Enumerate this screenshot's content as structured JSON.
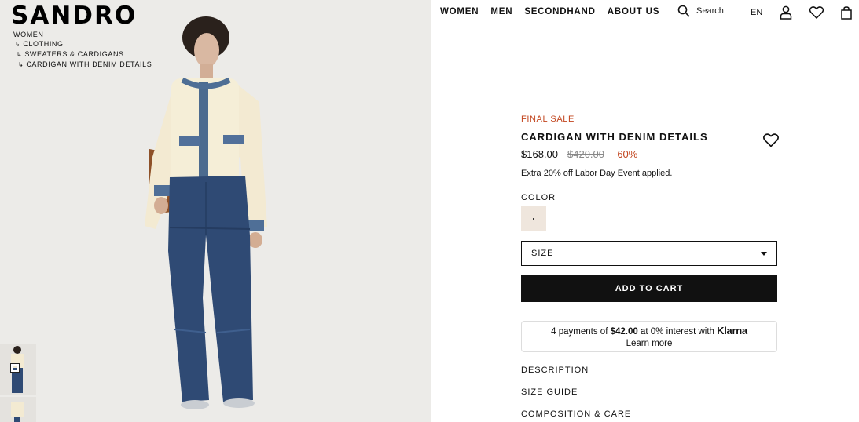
{
  "brand": "SANDRO",
  "breadcrumbs": [
    "WOMEN",
    "CLOTHING",
    "SWEATERS & CARDIGANS",
    "CARDIGAN WITH DENIM DETAILS"
  ],
  "nav": [
    "WOMEN",
    "MEN",
    "SECONDHAND",
    "ABOUT US"
  ],
  "search": {
    "label": "Search",
    "icon": "search-icon"
  },
  "header_icons": {
    "language": "EN",
    "account": "user-icon",
    "wishlist": "heart-icon",
    "cart": "bag-icon"
  },
  "product": {
    "badge": "FINAL SALE",
    "title": "CARDIGAN WITH DENIM DETAILS",
    "price": "$168.00",
    "original_price": "$420.00",
    "discount": "-60%",
    "promo": "Extra 20% off Labor Day Event applied.",
    "color_label": "COLOR",
    "size_label": "SIZE",
    "add_to_cart": "ADD TO CART"
  },
  "klarna": {
    "prefix": "4 payments of",
    "amount": "$42.00",
    "suffix": "at 0% interest with",
    "brand": "Klarna",
    "learn_more": "Learn more"
  },
  "accordions": [
    "DESCRIPTION",
    "SIZE GUIDE",
    "COMPOSITION & CARE"
  ],
  "colors": {
    "sale": "#c2451e",
    "button": "#111111",
    "swatch": "#efe6dd"
  }
}
